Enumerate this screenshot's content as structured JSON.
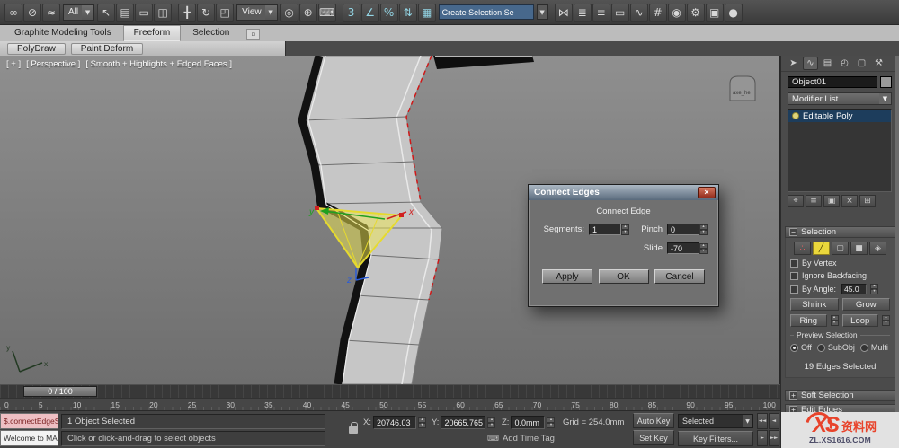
{
  "colors": {
    "selection_yellow": "#ead73c",
    "axis_x": "#d02020",
    "axis_y": "#1fa01f",
    "axis_z": "#2b5cd8",
    "watermark_red": "#e8432b"
  },
  "toolbar": {
    "filter_value": "All",
    "coord_value": "View",
    "sets_value": "Create Selection Se",
    "icons_a": [
      {
        "name": "select-and-link-icon",
        "glyph": "∞"
      },
      {
        "name": "unlink-selection-icon",
        "glyph": "⊘"
      },
      {
        "name": "bind-to-space-warp-icon",
        "glyph": "≈"
      }
    ],
    "icons_b": [
      {
        "name": "select-object-icon",
        "glyph": "↖"
      },
      {
        "name": "select-by-name-icon",
        "glyph": "▤"
      },
      {
        "name": "rectangular-selection-icon",
        "glyph": "▭"
      },
      {
        "name": "window-crossing-icon",
        "glyph": "◫"
      }
    ],
    "icons_c": [
      {
        "name": "select-and-move-icon",
        "glyph": "╋"
      },
      {
        "name": "select-and-rotate-icon",
        "glyph": "↻"
      },
      {
        "name": "select-and-scale-icon",
        "glyph": "◰"
      }
    ],
    "icons_d": [
      {
        "name": "use-pivot-center-icon",
        "glyph": "◎"
      },
      {
        "name": "select-and-manipulate-icon",
        "glyph": "⊕"
      },
      {
        "name": "keyboard-override-icon",
        "glyph": "⌨"
      }
    ],
    "icons_e": [
      {
        "name": "snaps-toggle-icon",
        "glyph": "3"
      },
      {
        "name": "angle-snap-icon",
        "glyph": "∠"
      },
      {
        "name": "percent-snap-icon",
        "glyph": "%"
      },
      {
        "name": "spinner-snap-icon",
        "glyph": "⇅"
      },
      {
        "name": "edit-named-selections-icon",
        "glyph": "▦"
      }
    ],
    "icons_f": [
      {
        "name": "mirror-icon",
        "glyph": "⋈"
      },
      {
        "name": "align-icon",
        "glyph": "≣"
      },
      {
        "name": "layer-manager-icon",
        "glyph": "≡"
      },
      {
        "name": "ribbon-toggle-icon",
        "glyph": "▭"
      },
      {
        "name": "curve-editor-icon",
        "glyph": "∿"
      },
      {
        "name": "schematic-view-icon",
        "glyph": "#"
      },
      {
        "name": "material-editor-icon",
        "glyph": "◉"
      },
      {
        "name": "render-setup-icon",
        "glyph": "⚙"
      },
      {
        "name": "rendered-frame-icon",
        "glyph": "▣"
      },
      {
        "name": "render-production-icon",
        "glyph": "●"
      }
    ]
  },
  "ribbon": {
    "tabs": [
      {
        "name": "tab-graphite-modeling-tools",
        "label": "Graphite Modeling Tools"
      },
      {
        "name": "tab-freeform",
        "label": "Freeform",
        "active": true
      },
      {
        "name": "tab-selection",
        "label": "Selection"
      }
    ],
    "collapse_glyph": "▫",
    "panels": [
      {
        "name": "polydraw-button",
        "label": "PolyDraw"
      },
      {
        "name": "paint-deform-button",
        "label": "Paint Deform"
      }
    ]
  },
  "viewport": {
    "label_plus": "[ + ]",
    "label_view": "[ Perspective ]",
    "label_shading": "[ Smooth + Highlights + Edged Faces ]",
    "scene_object_label": "axe_he",
    "axis_x": "x",
    "axis_y": "y",
    "axis_z": "z",
    "world_x": "x",
    "world_y": "y"
  },
  "dialog": {
    "title": "Connect Edges",
    "close_glyph": "×",
    "group_label": "Connect Edge",
    "segments_label": "Segments:",
    "segments_value": "1",
    "pinch_label": "Pinch",
    "pinch_value": "0",
    "slide_label": "Slide",
    "slide_value": "-70",
    "apply": "Apply",
    "ok": "OK",
    "cancel": "Cancel"
  },
  "command_panel": {
    "tabs": [
      {
        "name": "create-tab-icon",
        "glyph": "➤"
      },
      {
        "name": "modify-tab-icon",
        "glyph": "∿",
        "active": true
      },
      {
        "name": "hierarchy-tab-icon",
        "glyph": "▤"
      },
      {
        "name": "motion-tab-icon",
        "glyph": "◴"
      },
      {
        "name": "display-tab-icon",
        "glyph": "▢"
      },
      {
        "name": "utilities-tab-icon",
        "glyph": "⚒"
      }
    ],
    "object_name": "Object01",
    "modifier_list": "Modifier List",
    "stack_item": "Editable Poly",
    "stack_icons": [
      {
        "name": "pin-stack-icon",
        "glyph": "⌖"
      },
      {
        "name": "show-end-result-icon",
        "glyph": "≡"
      },
      {
        "name": "make-unique-icon",
        "glyph": "▣"
      },
      {
        "name": "remove-modifier-icon",
        "glyph": "×"
      },
      {
        "name": "configure-modifier-sets-icon",
        "glyph": "⊞"
      }
    ],
    "selection": {
      "title": "Selection",
      "minus_glyph": "−",
      "subobject": [
        {
          "name": "vertex-subobject-icon",
          "glyph": "∴"
        },
        {
          "name": "edge-subobject-icon",
          "glyph": "╱",
          "active": true
        },
        {
          "name": "border-subobject-icon",
          "glyph": "▢"
        },
        {
          "name": "polygon-subobject-icon",
          "glyph": "■"
        },
        {
          "name": "element-subobject-icon",
          "glyph": "◈"
        }
      ],
      "by_vertex": "By Vertex",
      "ignore_backfacing": "Ignore Backfacing",
      "by_angle": "By Angle:",
      "angle_value": "45.0",
      "shrink": "Shrink",
      "grow": "Grow",
      "ring": "Ring",
      "loop": "Loop",
      "preview_label": "Preview Selection",
      "preview_options": [
        {
          "name": "preview-off-radio",
          "label": "Off",
          "active": true
        },
        {
          "name": "preview-subobj-radio",
          "label": "SubObj"
        },
        {
          "name": "preview-multi-radio",
          "label": "Multi"
        }
      ],
      "status": "19 Edges Selected"
    },
    "soft_selection": "Soft Selection",
    "edit_edges": "Edit Edges",
    "plus_glyph": "+"
  },
  "timeline": {
    "slider": "0 / 100",
    "ticks": [
      "0",
      "5",
      "10",
      "15",
      "20",
      "25",
      "30",
      "35",
      "40",
      "45",
      "50",
      "55",
      "60",
      "65",
      "70",
      "75",
      "80",
      "85",
      "90",
      "95",
      "100"
    ]
  },
  "status": {
    "script_line1": "$.connectEdgeS",
    "script_line2": "Welcome to MAX",
    "selection": "1 Object Selected",
    "prompt": "Click or click-and-drag to select objects",
    "x_label": "X:",
    "x_value": "20746.03",
    "y_label": "Y:",
    "y_value": "20665.765",
    "z_label": "Z:",
    "z_value": "0.0mm",
    "grid": "Grid = 254.0mm",
    "add_time_tag": "Add Time Tag",
    "auto_key": "Auto Key",
    "set_key": "Set Key",
    "selected": "Selected",
    "key_filters": "Key Filters...",
    "playback": [
      {
        "name": "go-to-start-button",
        "glyph": "◄◄"
      },
      {
        "name": "previous-frame-button",
        "glyph": "◄"
      },
      {
        "name": "next-frame-button",
        "glyph": "►"
      },
      {
        "name": "go-to-end-button",
        "glyph": "►►"
      }
    ]
  },
  "watermark": {
    "logo": "XS",
    "cn": "资料网",
    "url": "ZL.XS1616.COM"
  }
}
